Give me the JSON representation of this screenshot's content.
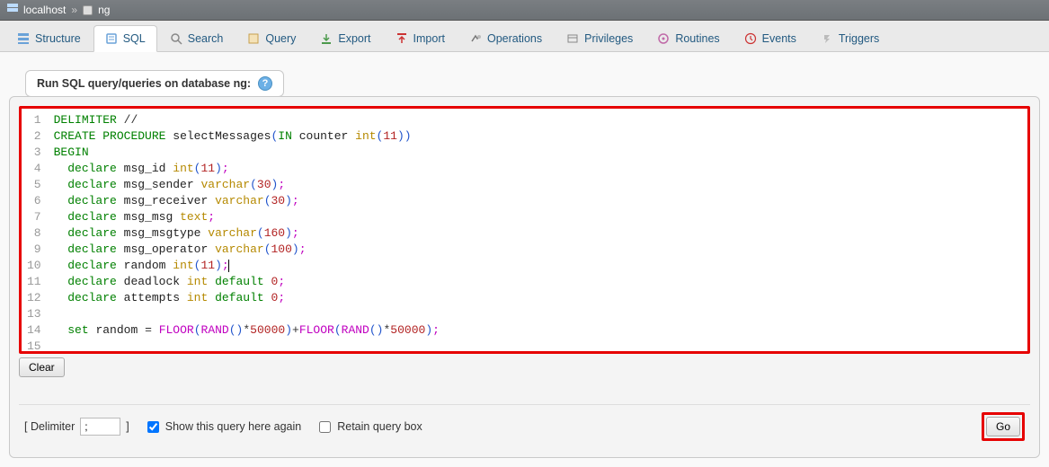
{
  "breadcrumb": {
    "server": "localhost",
    "separator": "»",
    "database": "ng"
  },
  "tabs": [
    {
      "key": "structure",
      "label": "Structure",
      "active": false
    },
    {
      "key": "sql",
      "label": "SQL",
      "active": true
    },
    {
      "key": "search",
      "label": "Search",
      "active": false
    },
    {
      "key": "query",
      "label": "Query",
      "active": false
    },
    {
      "key": "export",
      "label": "Export",
      "active": false
    },
    {
      "key": "import",
      "label": "Import",
      "active": false
    },
    {
      "key": "operations",
      "label": "Operations",
      "active": false
    },
    {
      "key": "privileges",
      "label": "Privileges",
      "active": false
    },
    {
      "key": "routines",
      "label": "Routines",
      "active": false
    },
    {
      "key": "events",
      "label": "Events",
      "active": false
    },
    {
      "key": "triggers",
      "label": "Triggers",
      "active": false
    }
  ],
  "panel": {
    "title": "Run SQL query/queries on database ng: "
  },
  "buttons": {
    "clear": "Clear",
    "go": "Go"
  },
  "footer": {
    "delimiter_label_open": "[ Delimiter",
    "delimiter_value": ";",
    "delimiter_label_close": "]",
    "show_again": "Show this query here again",
    "show_again_checked": true,
    "retain": "Retain query box",
    "retain_checked": false
  },
  "editor": {
    "line_count": 15,
    "lines": [
      "DELIMITER //",
      "CREATE PROCEDURE selectMessages(IN counter int(11))",
      "BEGIN",
      "  declare msg_id int(11);",
      "  declare msg_sender varchar(30);",
      "  declare msg_receiver varchar(30);",
      "  declare msg_msg text;",
      "  declare msg_msgtype varchar(160);",
      "  declare msg_operator varchar(100);",
      "  declare random int(11);",
      "  declare deadlock int default 0;",
      "  declare attempts int default 0;",
      "",
      "  set random = FLOOR(RAND()*50000)+FLOOR(RAND()*50000);",
      ""
    ]
  }
}
